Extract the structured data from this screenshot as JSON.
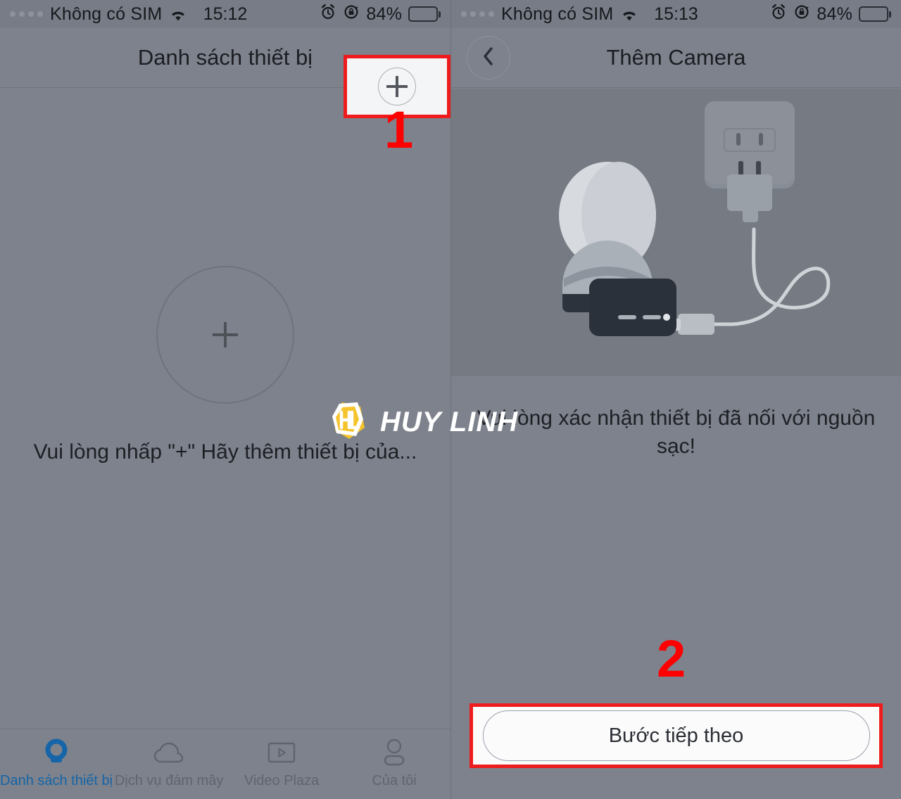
{
  "left": {
    "status": {
      "carrier": "Không có SIM",
      "time": "15:12",
      "battery_percent": "84%",
      "signal_icon": "signal-dots-icon",
      "wifi_icon": "wifi-icon",
      "alarm_icon": "alarm-clock-icon",
      "rotation_icon": "rotation-lock-icon",
      "battery_icon": "battery-icon"
    },
    "nav": {
      "title": "Danh sách thiết bị",
      "add_icon": "plus-icon"
    },
    "empty_state": {
      "plus_icon": "plus-icon",
      "message": "Vui lòng nhấp \"+\" Hãy thêm thiết bị của..."
    },
    "tabs": [
      {
        "label": "Danh sách thiết bị",
        "icon": "camera-icon",
        "active": true
      },
      {
        "label": "Dịch vụ đám mây",
        "icon": "cloud-icon",
        "active": false
      },
      {
        "label": "Video Plaza",
        "icon": "video-play-icon",
        "active": false
      },
      {
        "label": "Của tôi",
        "icon": "person-icon",
        "active": false
      }
    ],
    "step_marker": "1"
  },
  "right": {
    "status": {
      "carrier": "Không có SIM",
      "time": "15:13",
      "battery_percent": "84%",
      "signal_icon": "signal-dots-icon",
      "wifi_icon": "wifi-icon",
      "alarm_icon": "alarm-clock-icon",
      "rotation_icon": "rotation-lock-icon",
      "battery_icon": "battery-icon"
    },
    "nav": {
      "title": "Thêm Camera",
      "back_icon": "chevron-left-icon"
    },
    "illustration": "camera-charging-illustration",
    "instruction": "Vui lòng xác nhận thiết bị đã nối với nguồn sạc!",
    "next_button": "Bước tiếp theo",
    "step_marker": "2"
  },
  "watermark": {
    "text": "HUY LINH",
    "logo_icon": "hl-hexagon-logo-icon"
  },
  "colors": {
    "background": "#7d828c",
    "statusbar": "#777c86",
    "illustration_panel": "#767b83",
    "annotation_red": "#ee1c1c",
    "active_tab_blue": "#1565a8",
    "watermark_yellow": "#f5c32c"
  }
}
